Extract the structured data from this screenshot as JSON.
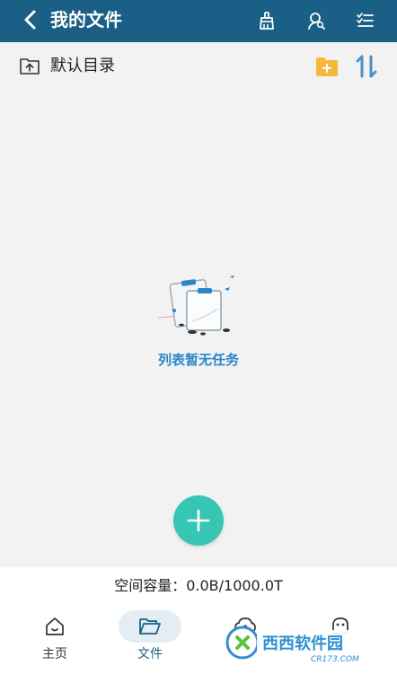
{
  "header": {
    "title": "我的文件",
    "icons": [
      "back-arrow-icon",
      "broom-clean-icon",
      "user-search-icon",
      "checklist-icon"
    ]
  },
  "directory": {
    "label": "默认目录",
    "icons": [
      "folder-up-icon",
      "new-folder-icon",
      "sort-icon"
    ]
  },
  "empty_state": {
    "message": "列表暂无任务"
  },
  "footer": {
    "capacity": "空间容量：0.0B/1000.0T"
  },
  "nav": {
    "items": [
      {
        "label": "主页",
        "icon": "home-icon"
      },
      {
        "label": "文件",
        "icon": "folder-open-icon",
        "active": true
      },
      {
        "label": "",
        "icon": "cloud-upload-icon"
      },
      {
        "label": "",
        "icon": "profile-icon"
      }
    ]
  },
  "watermark": {
    "text_main": "西西软件园",
    "text_sub": "CR173.COM"
  },
  "colors": {
    "header_bg": "#1a5f86",
    "accent_teal": "#37c6b4",
    "folder_yellow": "#f6b83a",
    "sort_blue": "#4a90c9",
    "empty_text_blue": "#2a86c9"
  }
}
